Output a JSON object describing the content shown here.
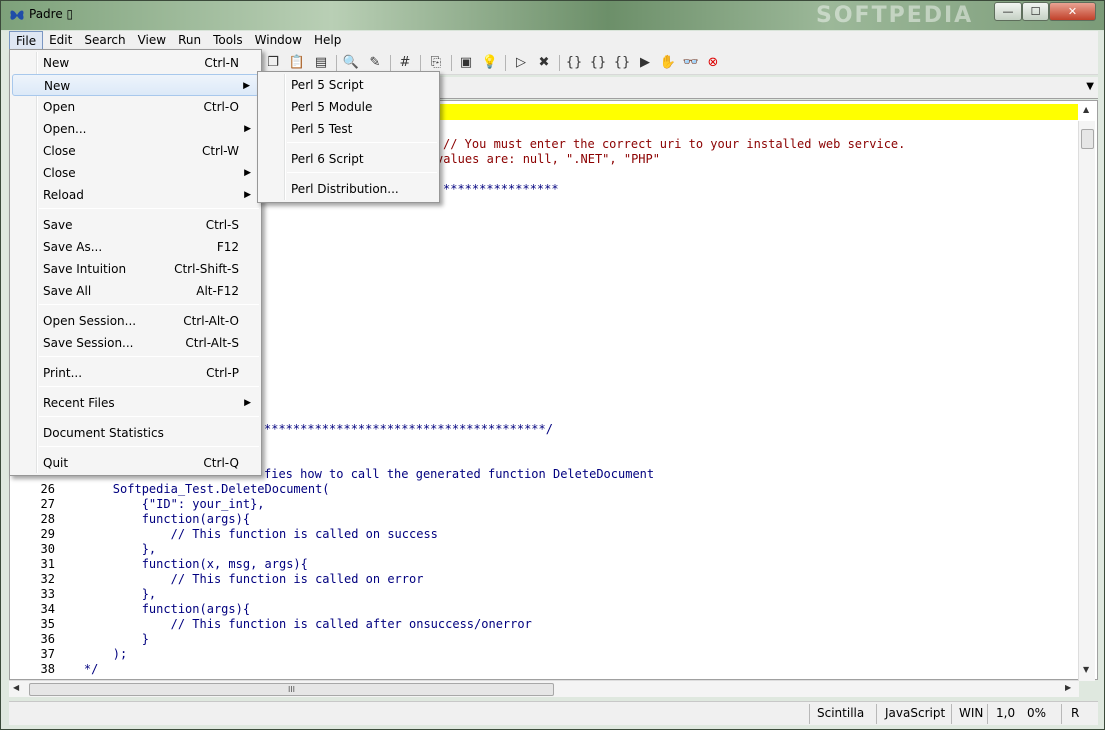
{
  "window": {
    "title": "Padre ▯",
    "watermark": "SOFTPEDIA",
    "controls": {
      "minimize": "—",
      "maximize": "☐",
      "close": "✕"
    }
  },
  "menubar": {
    "items": [
      {
        "label": "File"
      },
      {
        "label": "Edit"
      },
      {
        "label": "Search"
      },
      {
        "label": "View"
      },
      {
        "label": "Run"
      },
      {
        "label": "Tools"
      },
      {
        "label": "Window"
      },
      {
        "label": "Help"
      }
    ]
  },
  "file_menu": {
    "items": [
      {
        "label": "New",
        "shortcut": "Ctrl-N"
      },
      {
        "label": "New",
        "shortcut": "",
        "submenu": true
      },
      {
        "label": "Open",
        "shortcut": "Ctrl-O"
      },
      {
        "label": "Open...",
        "shortcut": "",
        "submenu": true
      },
      {
        "label": "Close",
        "shortcut": "Ctrl-W"
      },
      {
        "label": "Close",
        "shortcut": "",
        "submenu": true
      },
      {
        "label": "Reload",
        "shortcut": "",
        "submenu": true
      },
      {
        "label": "Save",
        "shortcut": "Ctrl-S"
      },
      {
        "label": "Save As...",
        "shortcut": "F12"
      },
      {
        "label": "Save Intuition",
        "shortcut": "Ctrl-Shift-S"
      },
      {
        "label": "Save All",
        "shortcut": "Alt-F12"
      },
      {
        "label": "Open Session...",
        "shortcut": "Ctrl-Alt-O"
      },
      {
        "label": "Save Session...",
        "shortcut": "Ctrl-Alt-S"
      },
      {
        "label": "Print...",
        "shortcut": "Ctrl-P"
      },
      {
        "label": "Recent Files",
        "shortcut": "",
        "submenu": true
      },
      {
        "label": "Document Statistics",
        "shortcut": ""
      },
      {
        "label": "Quit",
        "shortcut": "Ctrl-Q"
      }
    ]
  },
  "new_submenu": {
    "items": [
      {
        "label": "Perl 5 Script"
      },
      {
        "label": "Perl 5 Module"
      },
      {
        "label": "Perl 5 Test"
      },
      {
        "label": "Perl 6 Script"
      },
      {
        "label": "Perl Distribution..."
      }
    ]
  },
  "editor": {
    "visible_fragments": [
      {
        "text": "// You must enter the correct uri to your installed web service.",
        "kind": "comment"
      },
      {
        "text": "values are: null, \".NET\", \"PHP\"",
        "kind": "comment"
      },
      {
        "text": "****************",
        "kind": "code"
      },
      {
        "text": "***************************************/",
        "kind": "code"
      },
      {
        "text": "fies how to call the generated function DeleteDocument",
        "kind": "code"
      }
    ],
    "lines": [
      {
        "num": "26",
        "text": "        Softpedia_Test.DeleteDocument(",
        "kind": "code"
      },
      {
        "num": "27",
        "text": "            {\"ID\": your_int},",
        "kind": "code"
      },
      {
        "num": "28",
        "text": "            function(args){",
        "kind": "code"
      },
      {
        "num": "29",
        "text": "                // This function is called on success",
        "kind": "code"
      },
      {
        "num": "30",
        "text": "            },",
        "kind": "code"
      },
      {
        "num": "31",
        "text": "            function(x, msg, args){",
        "kind": "code"
      },
      {
        "num": "32",
        "text": "                // This function is called on error",
        "kind": "code"
      },
      {
        "num": "33",
        "text": "            },",
        "kind": "code"
      },
      {
        "num": "34",
        "text": "            function(args){",
        "kind": "code"
      },
      {
        "num": "35",
        "text": "                // This function is called after onsuccess/onerror",
        "kind": "code"
      },
      {
        "num": "36",
        "text": "            }",
        "kind": "code"
      },
      {
        "num": "37",
        "text": "        );",
        "kind": "code"
      },
      {
        "num": "38",
        "text": "    */",
        "kind": "code"
      }
    ],
    "hscroll_grip": "III"
  },
  "statusbar": {
    "editor_component": "Scintilla",
    "language": "JavaScript",
    "newline": "WIN",
    "position": "1,0",
    "percent": "0%",
    "mode": "R"
  },
  "colors": {
    "current_line": "#ffff00",
    "comment": "#8b0000",
    "code": "#00007f"
  }
}
